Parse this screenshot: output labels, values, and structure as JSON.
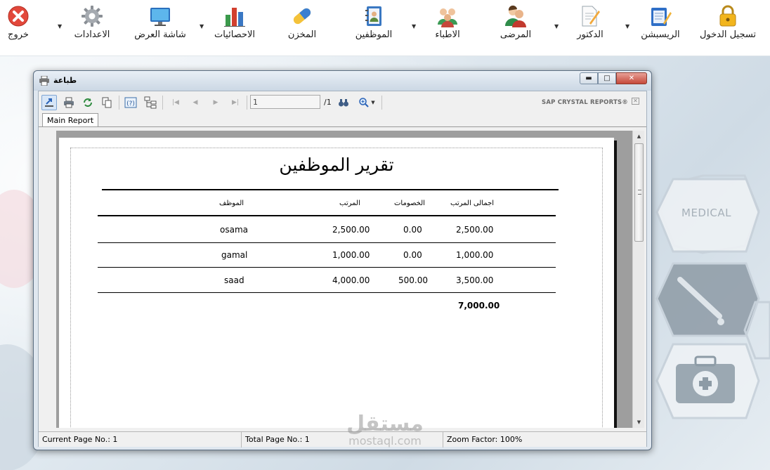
{
  "menu": {
    "items": [
      {
        "id": "login",
        "label": "تسجيل الدخول",
        "icon": "lock-icon"
      },
      {
        "id": "reception",
        "label": "الريسبشن",
        "icon": "notepad-pencil-icon"
      },
      {
        "id": "doctor",
        "label": "الدكتور",
        "icon": "document-edit-icon"
      },
      {
        "id": "patients",
        "label": "المرضى",
        "icon": "patients-icon"
      },
      {
        "id": "doctors",
        "label": "الاطباء",
        "icon": "doctors-group-icon"
      },
      {
        "id": "employees",
        "label": "الموظفين",
        "icon": "employee-address-book-icon"
      },
      {
        "id": "store",
        "label": "المخزن",
        "icon": "capsule-icon"
      },
      {
        "id": "statistics",
        "label": "الاحصائيات",
        "icon": "bar-chart-icon"
      },
      {
        "id": "display",
        "label": "شاشة العرض",
        "icon": "monitor-icon"
      },
      {
        "id": "settings",
        "label": "الاعدادات",
        "icon": "gear-icon"
      },
      {
        "id": "exit",
        "label": "خروج",
        "icon": "close-circle-icon"
      }
    ]
  },
  "background": {
    "medical_label": "MEDICAL"
  },
  "window": {
    "title": "طباعة",
    "buttons": {
      "minimize": "minimize",
      "maximize": "maximize",
      "close": "close"
    }
  },
  "toolbar": {
    "page_value": "1",
    "page_total": "/1",
    "brand": "SAP CRYSTAL REPORTS®"
  },
  "tabs": [
    {
      "label": "Main Report"
    }
  ],
  "report": {
    "title": "تقرير الموظفين",
    "columns": {
      "employee": "الموظف",
      "salary": "المرتب",
      "deductions": "الخصومات",
      "total_salary": "اجمالى المرتب"
    },
    "rows": [
      {
        "employee": "osama",
        "salary": "2,500.00",
        "deductions": "0.00",
        "total": "2,500.00"
      },
      {
        "employee": "gamal",
        "salary": "1,000.00",
        "deductions": "0.00",
        "total": "1,000.00"
      },
      {
        "employee": "saad",
        "salary": "4,000.00",
        "deductions": "500.00",
        "total": "3,500.00"
      }
    ],
    "grand_total": "7,000.00"
  },
  "status": {
    "current_page": "Current Page No.: 1",
    "total_page": "Total Page No.: 1",
    "zoom": "Zoom Factor: 100%"
  },
  "watermark": {
    "arabic": "مستقل",
    "latin": "mostaql.com"
  }
}
